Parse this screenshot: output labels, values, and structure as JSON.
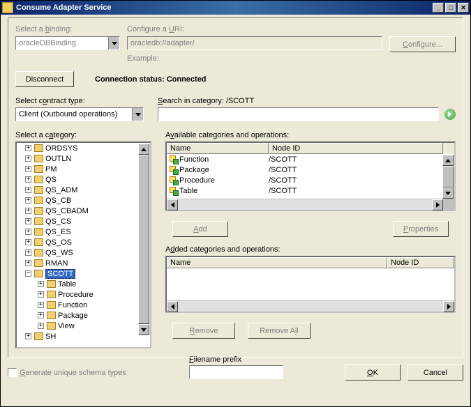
{
  "window": {
    "title": "Consume Adapter Service"
  },
  "top": {
    "binding_label": "Select a binding:",
    "binding_value": "oracleDBBinding",
    "uri_label": "Configure a URI:",
    "uri_value": "oracledb://adapter/",
    "example_label": "Example:",
    "configure_btn": "Configure..."
  },
  "conn": {
    "disconnect_btn": "Disconnect",
    "status_label": "Connection status:",
    "status_value": "Connected"
  },
  "search": {
    "contract_label": "Select contract type:",
    "contract_value": "Client (Outbound operations)",
    "search_label": "Search in category: /SCOTT"
  },
  "tree": {
    "header": "Select a category:",
    "items": [
      {
        "name": "ORDSYS",
        "depth": 1,
        "exp": "+"
      },
      {
        "name": "OUTLN",
        "depth": 1,
        "exp": "+"
      },
      {
        "name": "PM",
        "depth": 1,
        "exp": "+"
      },
      {
        "name": "QS",
        "depth": 1,
        "exp": "+"
      },
      {
        "name": "QS_ADM",
        "depth": 1,
        "exp": "+"
      },
      {
        "name": "QS_CB",
        "depth": 1,
        "exp": "+"
      },
      {
        "name": "QS_CBADM",
        "depth": 1,
        "exp": "+"
      },
      {
        "name": "QS_CS",
        "depth": 1,
        "exp": "+"
      },
      {
        "name": "QS_ES",
        "depth": 1,
        "exp": "+"
      },
      {
        "name": "QS_OS",
        "depth": 1,
        "exp": "+"
      },
      {
        "name": "QS_WS",
        "depth": 1,
        "exp": "+"
      },
      {
        "name": "RMAN",
        "depth": 1,
        "exp": "+"
      },
      {
        "name": "SCOTT",
        "depth": 1,
        "exp": "−",
        "selected": true
      },
      {
        "name": "Table",
        "depth": 2,
        "exp": "+"
      },
      {
        "name": "Procedure",
        "depth": 2,
        "exp": "+"
      },
      {
        "name": "Function",
        "depth": 2,
        "exp": "+"
      },
      {
        "name": "Package",
        "depth": 2,
        "exp": "+"
      },
      {
        "name": "View",
        "depth": 2,
        "exp": "+"
      },
      {
        "name": "SH",
        "depth": 1,
        "exp": "+"
      }
    ]
  },
  "available": {
    "header": "Available categories and operations:",
    "col_name": "Name",
    "col_id": "Node ID",
    "rows": [
      {
        "name": "Function",
        "id": "/SCOTT"
      },
      {
        "name": "Package",
        "id": "/SCOTT"
      },
      {
        "name": "Procedure",
        "id": "/SCOTT"
      },
      {
        "name": "Table",
        "id": "/SCOTT"
      }
    ],
    "add_btn": "Add",
    "properties_btn": "Properties"
  },
  "added": {
    "header": "Added categories and operations:",
    "col_name": "Name",
    "col_id": "Node ID",
    "remove_btn": "Remove",
    "removeall_btn": "Remove All"
  },
  "bottom": {
    "gen_label": "Generate unique schema types",
    "prefix_label": "Filename prefix",
    "ok_btn": "OK",
    "cancel_btn": "Cancel"
  }
}
